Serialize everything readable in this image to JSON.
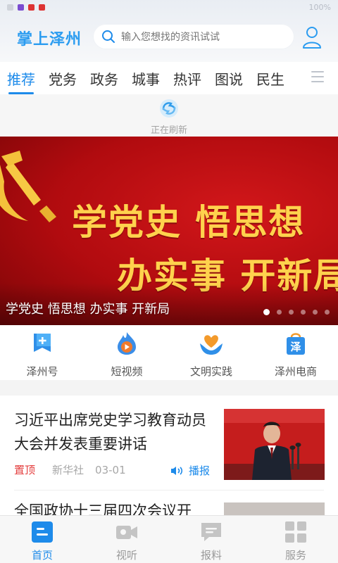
{
  "status_bar": {
    "left": "...",
    "right": "100%"
  },
  "header": {
    "brand": "掌上泽州",
    "search_placeholder": "输入您想找的资讯试试"
  },
  "tabs": [
    "推荐",
    "党务",
    "政务",
    "城事",
    "热评",
    "图说",
    "民生"
  ],
  "active_tab": "推荐",
  "refresh_text": "正在刷新",
  "banner": {
    "line1": "学党史 悟思想",
    "line2": "办实事 开新局",
    "caption": "学党史 悟思想 办实事 开新局",
    "slide_count": 6,
    "active_slide": 1
  },
  "shortcuts": [
    {
      "label": "泽州号",
      "icon": "plus-flag-icon"
    },
    {
      "label": "短视频",
      "icon": "flame-play-icon"
    },
    {
      "label": "文明实践",
      "icon": "heart-hands-icon"
    },
    {
      "label": "泽州电商",
      "icon": "shopping-bag-icon",
      "badge": "泽"
    }
  ],
  "news": [
    {
      "title": "习近平出席党史学习教育动员大会并发表重要讲话",
      "pin": "置顶",
      "source": "新华社",
      "date": "03-01",
      "play": "播报"
    },
    {
      "title": "全国政协十三届四次会议开"
    }
  ],
  "bottom_nav": [
    {
      "label": "首页",
      "icon": "home-icon"
    },
    {
      "label": "视听",
      "icon": "video-camera-icon"
    },
    {
      "label": "报料",
      "icon": "chat-bubble-icon"
    },
    {
      "label": "服务",
      "icon": "grid-icon"
    }
  ],
  "colors": {
    "accent": "#1e8bea",
    "pin": "#e33c3c",
    "banner_text": "#ffd24d"
  }
}
